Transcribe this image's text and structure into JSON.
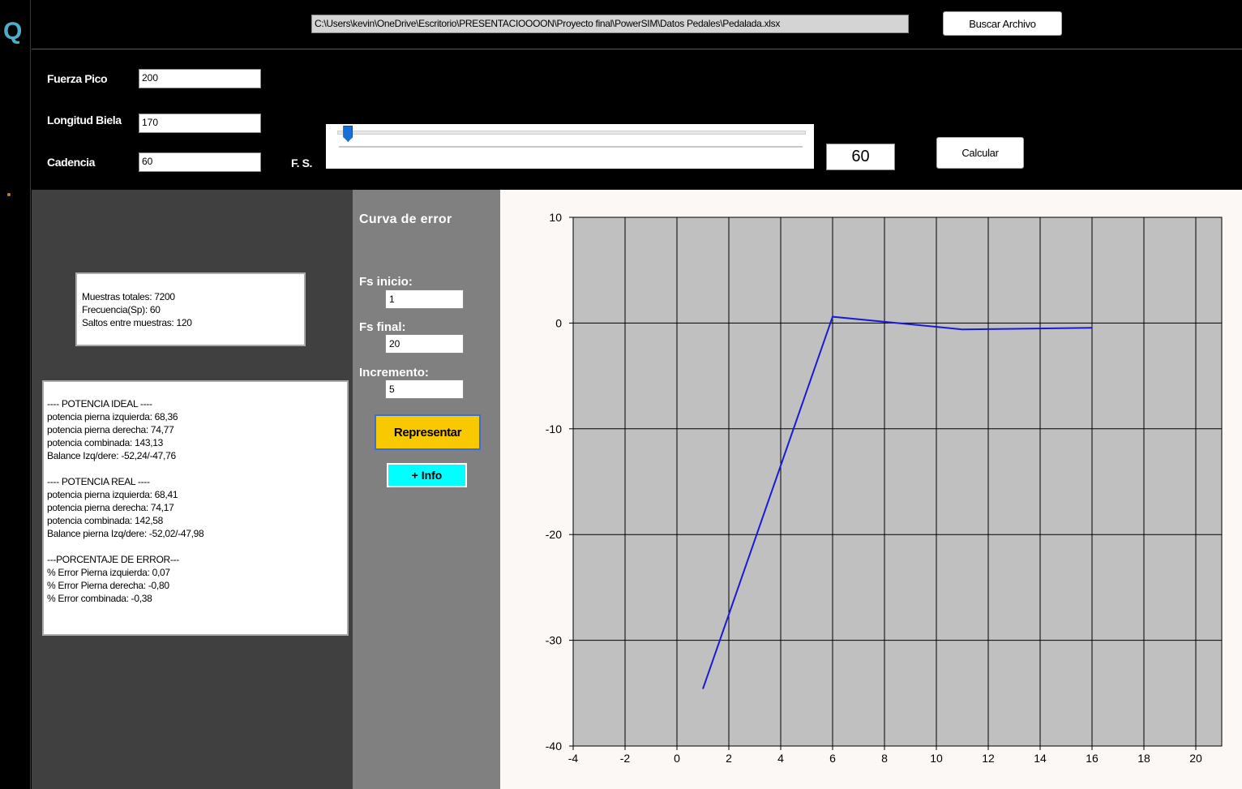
{
  "left_strip": {
    "logo_glyph": "Q"
  },
  "top": {
    "file_path": "C:\\Users\\kevin\\OneDrive\\Escritorio\\PRESENTACIOOOON\\Proyecto final\\PowerSIM\\Datos Pedales\\Pedalada.xlsx",
    "browse_label": "Buscar Archivo"
  },
  "params": {
    "fuerza_pico_label": "Fuerza Pico",
    "fuerza_pico_value": "200",
    "longitud_biela_label": "Longitud Biela",
    "longitud_biela_value": "170",
    "cadencia_label": "Cadencia",
    "cadencia_value": "60",
    "fs_label": "F. S.",
    "fs_slider_level": 0.03,
    "fs_value": "60",
    "calcular_label": "Calcular"
  },
  "samples_box": {
    "lines": [
      "Muestras totales: 7200",
      "Frecuencia(Sp): 60",
      "Saltos entre muestras: 120"
    ]
  },
  "results_box": {
    "ideal": [
      "---- POTENCIA IDEAL ----",
      "potencia pierna izquierda: 68,36",
      "potencia pierna derecha: 74,77",
      "potencia combinada: 143,13",
      "Balance Izq/dere: -52,24/-47,76"
    ],
    "real": [
      "---- POTENCIA REAL ----",
      "potencia pierna izquierda: 68,41",
      "potencia pierna derecha: 74,17",
      "potencia combinada: 142,58",
      "Balance pierna Izq/dere: -52,02/-47,98"
    ],
    "error": [
      "---PORCENTAJE DE ERROR---",
      "% Error Pierna izquierda: 0,07",
      "% Error Pierna derecha: -0,80",
      "% Error combinada: -0,38"
    ]
  },
  "error_curve": {
    "title": "Curva de error",
    "fs_inicio_label": "Fs inicio:",
    "fs_inicio_value": "1",
    "fs_final_label": "Fs final:",
    "fs_final_value": "20",
    "incremento_label": "Incremento:",
    "incremento_value": "5",
    "represent_label": "Representar",
    "info_label": "+ Info"
  },
  "colors": {
    "represent_button": "#f8c800",
    "info_button": "#00ffff",
    "plot_background": "#c0c0c0",
    "series_line": "#1a1ad6"
  },
  "chart_data": {
    "type": "line",
    "title": "",
    "xlabel": "",
    "ylabel": "",
    "xlim": [
      -4,
      21
    ],
    "ylim": [
      -40,
      10
    ],
    "x_ticks": [
      -4,
      -2,
      0,
      2,
      4,
      6,
      8,
      10,
      12,
      14,
      16,
      18,
      20
    ],
    "y_ticks": [
      10,
      0,
      -10,
      -20,
      -30,
      -40
    ],
    "grid": true,
    "legend": "none",
    "series": [
      {
        "x": [
          1,
          6,
          11,
          16
        ],
        "y": [
          -34.6,
          0.6,
          -0.6,
          -0.45
        ]
      }
    ]
  }
}
